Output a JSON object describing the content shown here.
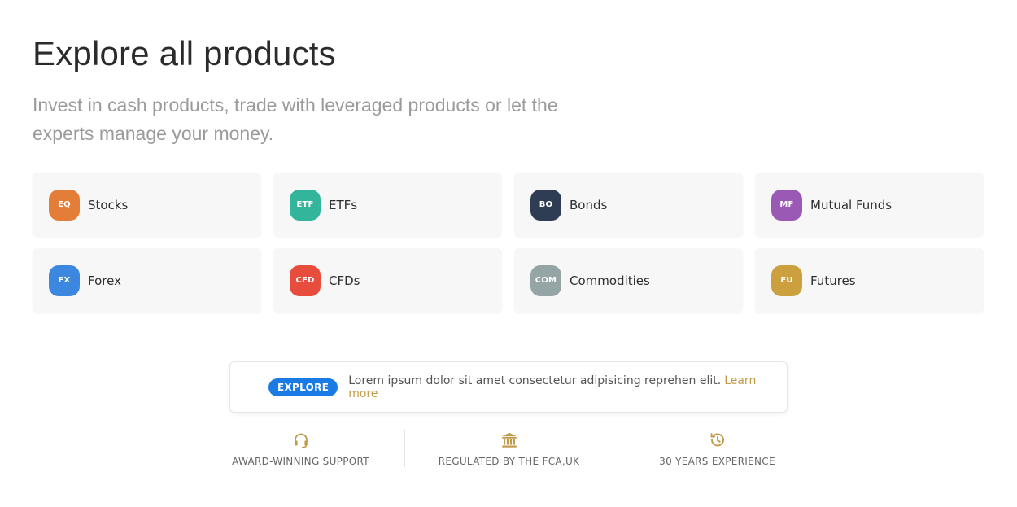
{
  "heading": {
    "prefix": "Explore all",
    "highlight": "products"
  },
  "subtitle": "Invest in cash products, trade with leveraged products or let the experts manage your money.",
  "products": [
    {
      "code": "EQ",
      "label": "Stocks",
      "color": "#e47d37"
    },
    {
      "code": "ETF",
      "label": "ETFs",
      "color": "#32b59a"
    },
    {
      "code": "BO",
      "label": "Bonds",
      "color": "#2f3d54"
    },
    {
      "code": "MF",
      "label": "Mutual Funds",
      "color": "#9b59b6"
    },
    {
      "code": "FX",
      "label": "Forex",
      "color": "#3c87e0"
    },
    {
      "code": "CFD",
      "label": "CFDs",
      "color": "#e74c3c"
    },
    {
      "code": "COM",
      "label": "Commodities",
      "color": "#95a5a6"
    },
    {
      "code": "FU",
      "label": "Futures",
      "color": "#cca03f"
    }
  ],
  "banner": {
    "pill": "EXPLORE",
    "text": "Lorem ipsum dolor sit amet consectetur adipisicing reprehen elit.",
    "link": "Learn more"
  },
  "features": [
    {
      "icon": "headset-icon",
      "label": "AWARD-WINNING SUPPORT"
    },
    {
      "icon": "bank-icon",
      "label": "REGULATED BY THE FCA,UK"
    },
    {
      "icon": "history-icon",
      "label": "30 YEARS EXPERIENCE"
    }
  ],
  "colors": {
    "accent": "#c29b48",
    "highlight": "#eadcb8",
    "pill": "#1a7be5"
  }
}
